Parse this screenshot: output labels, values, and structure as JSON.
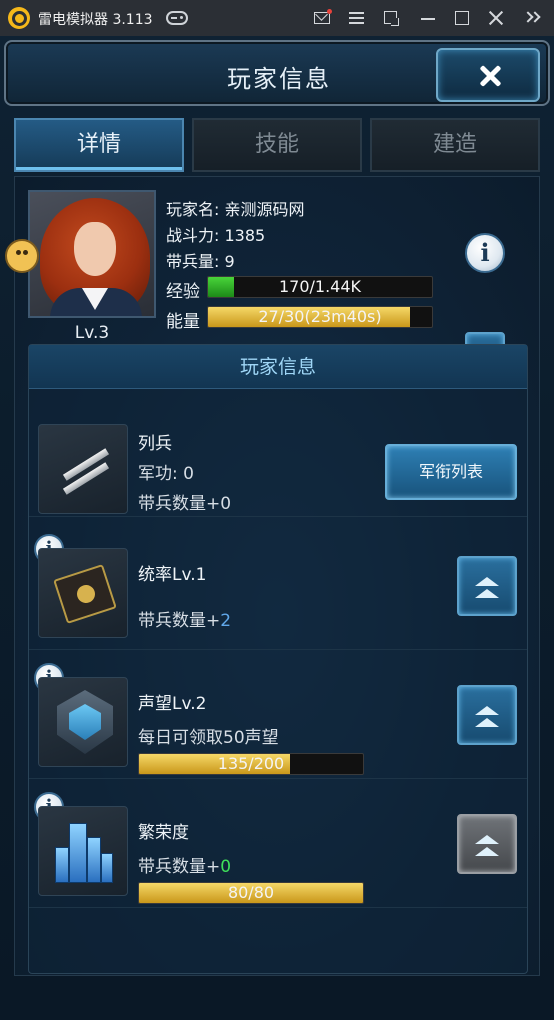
{
  "emulator": {
    "title": "雷电模拟器 3.113",
    "icons": [
      "app-logo",
      "gamepad-icon",
      "mail-icon",
      "menu-icon",
      "restore-icon",
      "minimize-icon",
      "maximize-icon",
      "close-icon",
      "expand-icon"
    ]
  },
  "header": {
    "title": "玩家信息",
    "close_icon": "close-icon"
  },
  "tabs": [
    {
      "label": "详情",
      "active": true
    },
    {
      "label": "技能",
      "active": false
    },
    {
      "label": "建造",
      "active": false
    }
  ],
  "profile": {
    "name_line": "玩家名: 亲测源码网",
    "power_line": "战斗力: 1385",
    "troops_line": "带兵量: 9",
    "level": "Lv.3",
    "exp_label": "经验",
    "exp_text": "170/1.44K",
    "exp_fraction": 0.118,
    "energy_label": "能量",
    "energy_text": "27/30(23m40s)",
    "energy_fraction": 0.9
  },
  "section": {
    "title": "玩家信息",
    "rows": [
      {
        "title": "列兵",
        "line1": "军功: 0",
        "line2": "带兵数量+0",
        "button_label": "军衔列表",
        "icon": "rank-stripes-icon"
      },
      {
        "title": "统率Lv.1",
        "line2_prefix": "带兵数量+",
        "line2_value": "2",
        "icon": "command-book-icon"
      },
      {
        "title": "声望Lv.2",
        "line1": "每日可领取50声望",
        "bar_text": "135/200",
        "bar_fraction": 0.675,
        "icon": "prestige-shield-icon"
      },
      {
        "title": "繁荣度",
        "line2_prefix": "带兵数量+",
        "line2_value": "0",
        "bar_text": "80/80",
        "bar_fraction": 1.0,
        "icon": "prosperity-city-icon"
      }
    ]
  },
  "colors": {
    "accent_blue": "#2e7fb4",
    "bar_gold": "#e0b83a",
    "bar_green": "#3cc82e",
    "value_green": "#3ee05a",
    "value_blue": "#61a8ea"
  }
}
